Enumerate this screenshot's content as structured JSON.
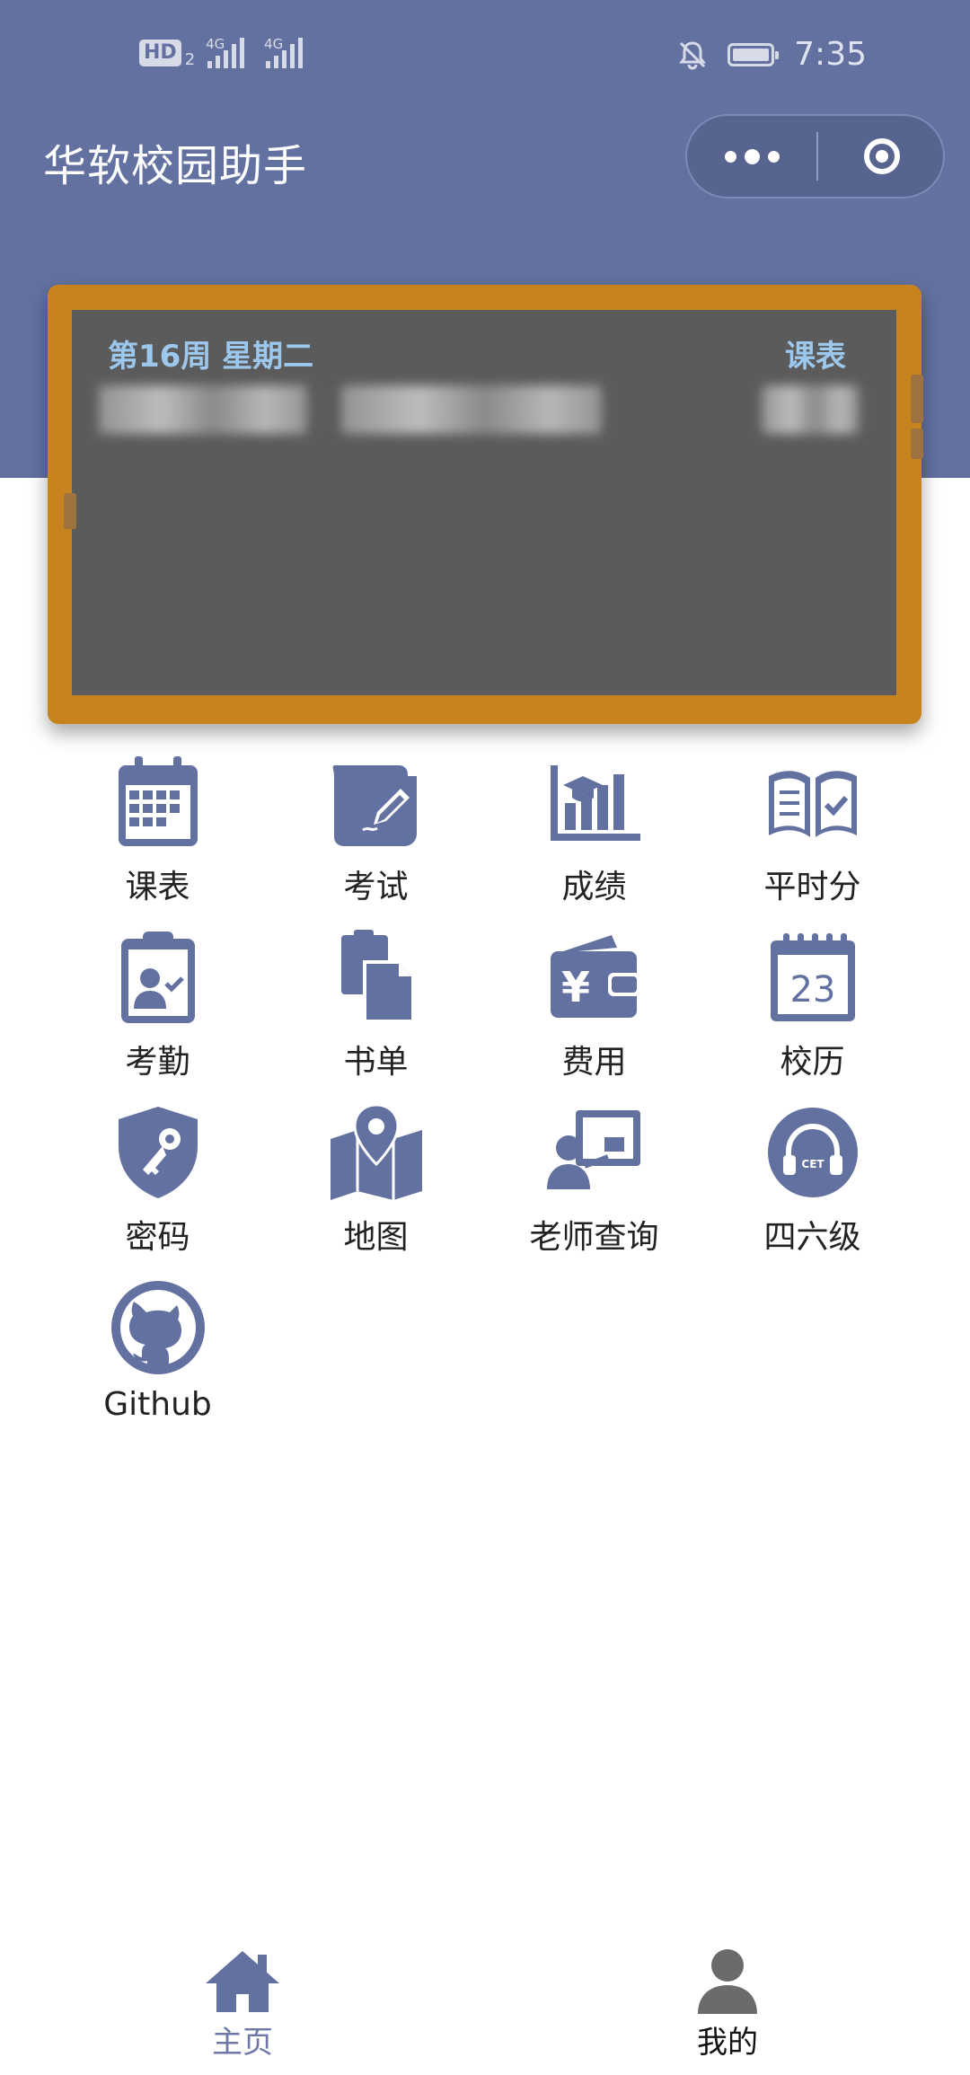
{
  "status_bar": {
    "hd": "HD",
    "hd_sub": "2",
    "net1": "4G",
    "net2": "4G",
    "time": "7:35"
  },
  "app": {
    "title": "华软校园助手"
  },
  "schedule_card": {
    "week_day": "第16周 星期二",
    "link": "课表"
  },
  "menu": [
    {
      "label": "课表",
      "icon": "calendar-icon"
    },
    {
      "label": "考试",
      "icon": "exam-scroll-icon"
    },
    {
      "label": "成绩",
      "icon": "grades-chart-icon"
    },
    {
      "label": "平时分",
      "icon": "book-check-icon"
    },
    {
      "label": "考勤",
      "icon": "attendance-clipboard-icon"
    },
    {
      "label": "书单",
      "icon": "booklist-documents-icon"
    },
    {
      "label": "费用",
      "icon": "wallet-yuan-icon"
    },
    {
      "label": "校历",
      "icon": "calendar-23-icon"
    },
    {
      "label": "密码",
      "icon": "shield-key-icon"
    },
    {
      "label": "地图",
      "icon": "map-pin-icon"
    },
    {
      "label": "老师查询",
      "icon": "teacher-board-icon"
    },
    {
      "label": "四六级",
      "icon": "cet-headphones-icon"
    },
    {
      "label": "Github",
      "icon": "github-icon"
    }
  ],
  "calendar_day": "23",
  "yuan_symbol": "¥",
  "cet_label": "CET",
  "tabbar": {
    "home": "主页",
    "me": "我的"
  },
  "colors": {
    "header": "#6371a1",
    "icon": "#6371a1",
    "board_frame": "#c6831e",
    "board": "#5b5b5b",
    "board_text": "#9cc8ee"
  }
}
